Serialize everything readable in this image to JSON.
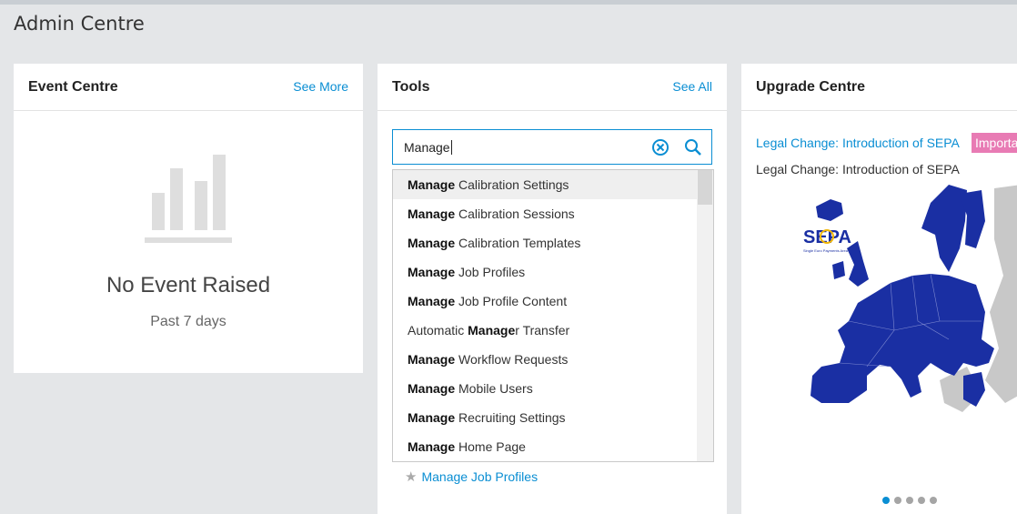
{
  "page": {
    "title": "Admin Centre"
  },
  "event_centre": {
    "title": "Event Centre",
    "see_more": "See More",
    "empty_title": "No Event Raised",
    "empty_subtitle": "Past 7 days"
  },
  "tools": {
    "title": "Tools",
    "see_all": "See All",
    "search_value": "Manage",
    "suggestions": [
      {
        "bold": "Manage",
        "rest": " Calibration Settings",
        "pre": ""
      },
      {
        "bold": "Manage",
        "rest": " Calibration Sessions",
        "pre": ""
      },
      {
        "bold": "Manage",
        "rest": " Calibration Templates",
        "pre": ""
      },
      {
        "bold": "Manage",
        "rest": " Job Profiles",
        "pre": ""
      },
      {
        "bold": "Manage",
        "rest": " Job Profile Content",
        "pre": ""
      },
      {
        "pre": "Automatic ",
        "bold": "Manage",
        "rest": "r Transfer"
      },
      {
        "bold": "Manage",
        "rest": " Workflow Requests",
        "pre": ""
      },
      {
        "bold": "Manage",
        "rest": " Mobile Users",
        "pre": ""
      },
      {
        "bold": "Manage",
        "rest": " Recruiting Settings",
        "pre": ""
      },
      {
        "bold": "Manage",
        "rest": " Home Page",
        "pre": ""
      }
    ],
    "favorite": "Manage Job Profiles"
  },
  "upgrade_centre": {
    "title": "Upgrade Centre",
    "link": "Legal Change: Introduction of SEPA",
    "badge": "Importa",
    "subtitle": "Legal Change: Introduction of SEPA",
    "map_logo": "SEPA",
    "map_logo_tag": "Single Euro Payments Area",
    "carousel_dots": 5,
    "carousel_active": 1
  },
  "colors": {
    "accent": "#0a8ed3",
    "badge": "#e87bb4",
    "map_member": "#1a2fa3",
    "map_other": "#c8c8c8"
  }
}
